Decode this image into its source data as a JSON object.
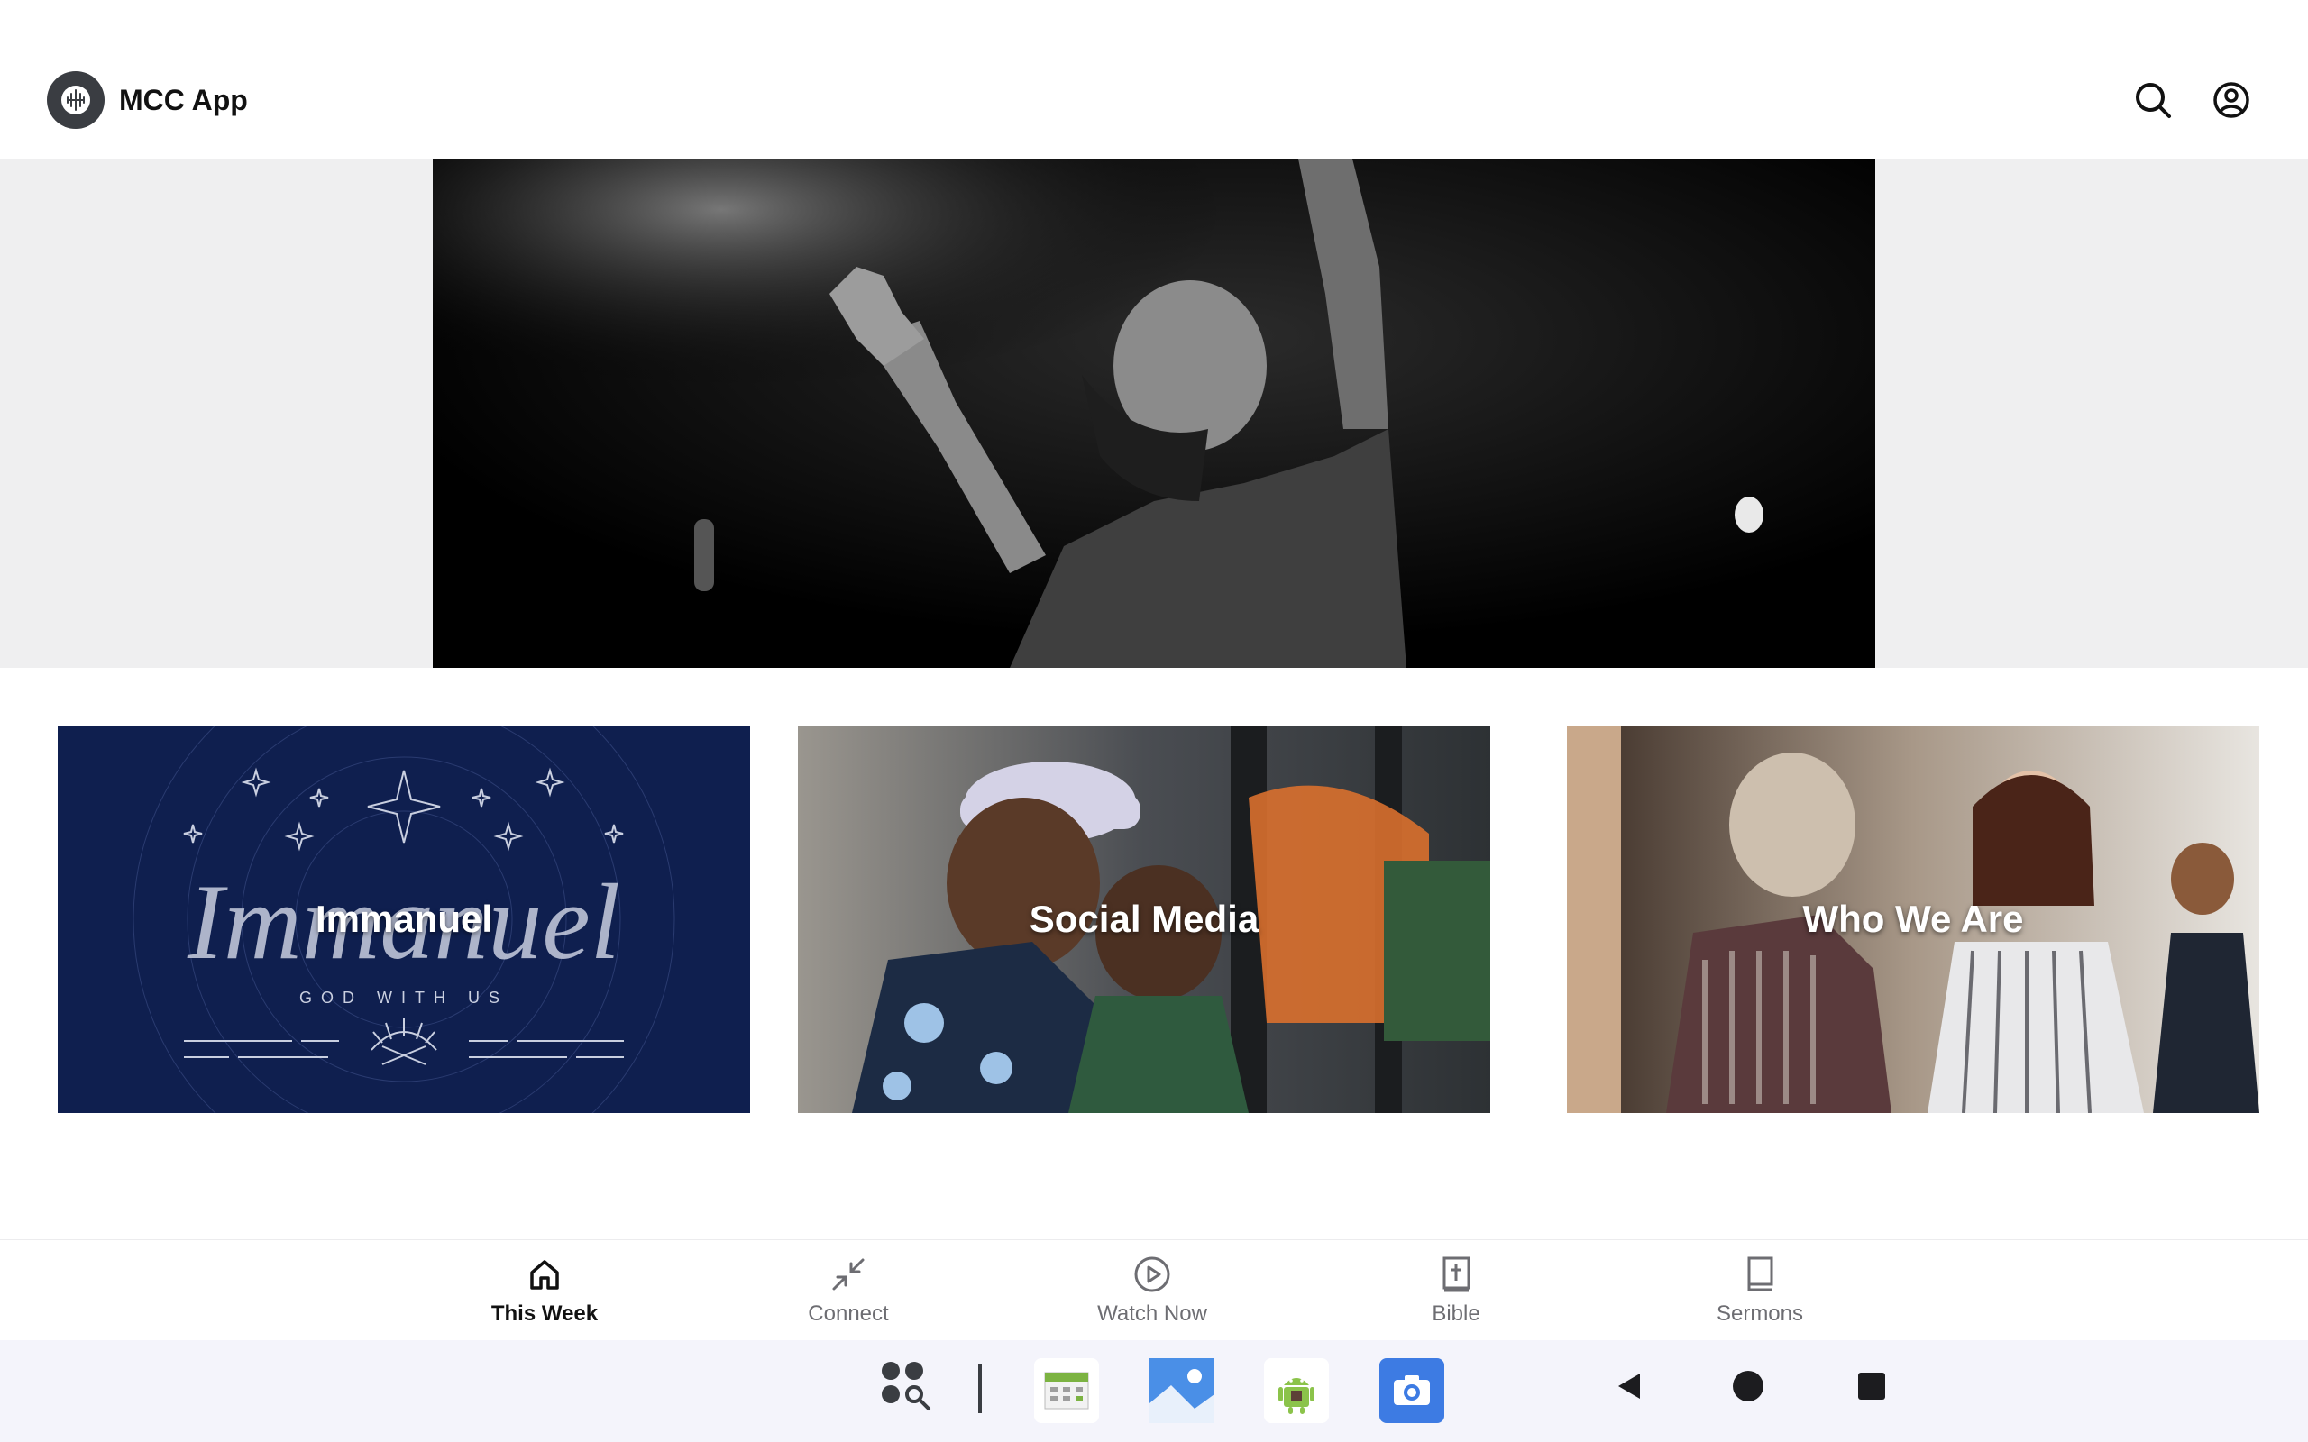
{
  "header": {
    "app_title": "MCC App",
    "logo_icon": "church-logo-icon",
    "search_icon": "search-icon",
    "account_icon": "account-icon"
  },
  "hero": {
    "image": "worship-man-raising-hands-photo"
  },
  "cards": [
    {
      "title": "Immanuel",
      "image": "immanuel-god-with-us-graphic",
      "art_script": "Immanuel",
      "art_sub": "GOD WITH US"
    },
    {
      "title": "Social Media",
      "image": "father-holding-baby-photo"
    },
    {
      "title": "Who We Are",
      "image": "two-women-talking-photo"
    }
  ],
  "tabbar": {
    "items": [
      {
        "label": "This Week",
        "icon": "home-icon",
        "active": true
      },
      {
        "label": "Connect",
        "icon": "compress-arrows-icon",
        "active": false
      },
      {
        "label": "Watch Now",
        "icon": "play-circle-icon",
        "active": false
      },
      {
        "label": "Bible",
        "icon": "bible-icon",
        "active": false
      },
      {
        "label": "Sermons",
        "icon": "book-icon",
        "active": false
      }
    ]
  },
  "system_nav": {
    "apps": [
      "app-search-icon",
      "calendar-app-icon",
      "gallery-app-icon",
      "android-app-icon",
      "camera-app-icon"
    ],
    "buttons": [
      "back-icon",
      "home-circle-icon",
      "recents-icon"
    ]
  },
  "colors": {
    "accent": "#111111",
    "inactive_tab": "#6d6d72",
    "hero_band": "#efeff0",
    "immanuel_bg": "#0f1f4f",
    "camera_app": "#3d7be3"
  }
}
